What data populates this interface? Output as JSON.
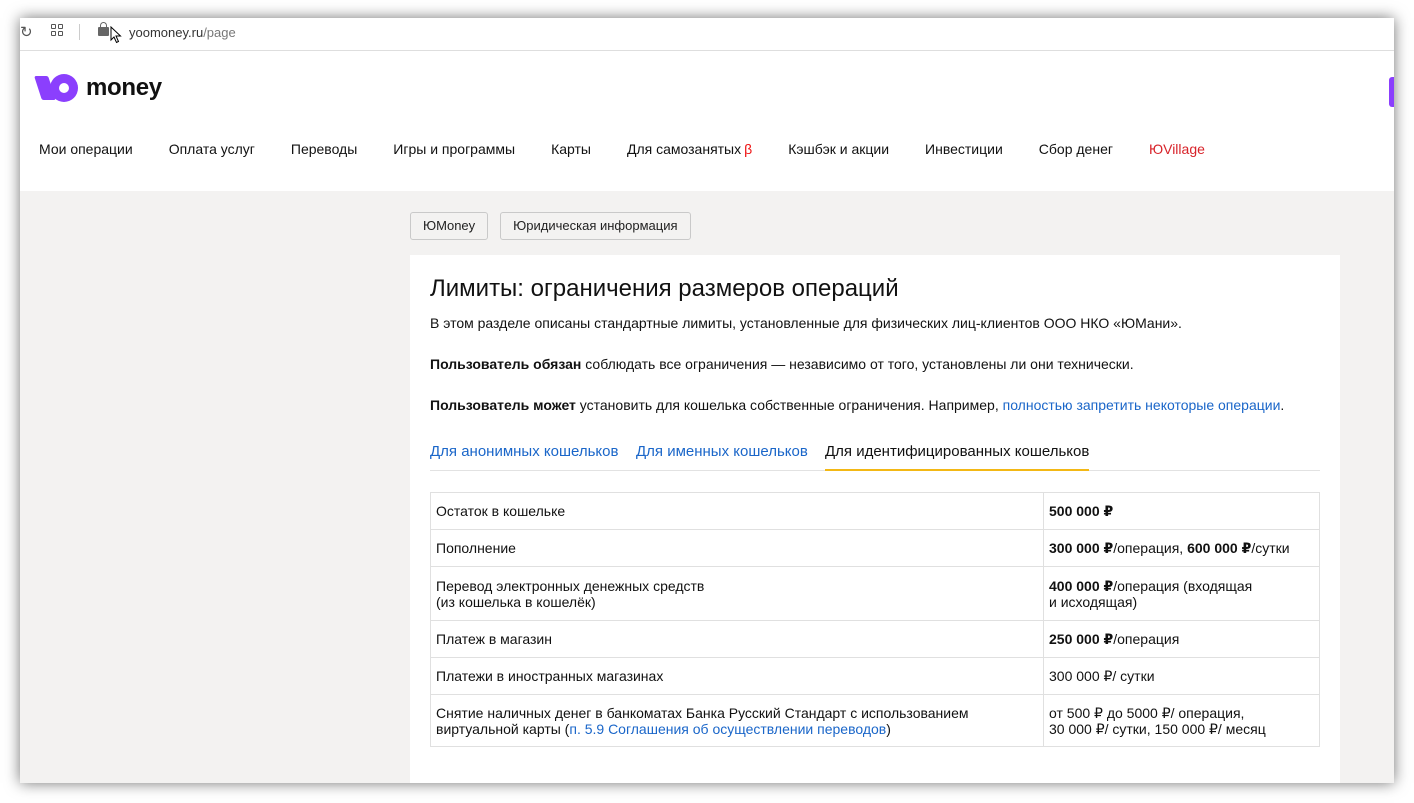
{
  "browser": {
    "url_domain": "yoomoney.ru",
    "url_path": "/page"
  },
  "header": {
    "logo_text": "money",
    "nav": [
      {
        "label": "Мои операции"
      },
      {
        "label": "Оплата услуг"
      },
      {
        "label": "Переводы"
      },
      {
        "label": "Игры и программы"
      },
      {
        "label": "Карты"
      },
      {
        "label": "Для самозанятых",
        "badge": "β"
      },
      {
        "label": "Кэшбэк и акции"
      },
      {
        "label": "Инвестиции"
      },
      {
        "label": "Сбор денег"
      },
      {
        "label": "ЮVillage"
      }
    ]
  },
  "breadcrumbs": [
    "ЮMoney",
    "Юридическая информация"
  ],
  "content": {
    "title": "Лимиты: ограничения размеров операций",
    "intro": "В этом разделе описаны стандартные лимиты, установленные для физических лиц-клиентов ООО НКО «ЮМани».",
    "p2_bold": "Пользователь обязан",
    "p2_rest": " соблюдать все ограничения — независимо от того, установлены ли они технически.",
    "p3_bold": "Пользователь может",
    "p3_rest": " установить для кошелька собственные ограничения. Например, ",
    "p3_link": "полностью запретить некоторые операции",
    "p3_end": ".",
    "tabs": [
      "Для анонимных кошельков",
      "Для именных кошельков",
      "Для идентифицированных кошельков"
    ],
    "table": {
      "r1_label": "Остаток в кошельке",
      "r1_value": "500 000 ₽",
      "r2_label": "Пополнение",
      "r2_v1": "300 000 ₽",
      "r2_t1": "/операция, ",
      "r2_v2": "600 000 ₽",
      "r2_t2": "/сутки",
      "r3_label_1": "Перевод электронных денежных средств",
      "r3_label_2": "(из кошелька в кошелёк)",
      "r3_v1": "400 000 ₽",
      "r3_t1": "/операция (входящая",
      "r3_t2": "и исходящая)",
      "r4_label": "Платеж в магазин",
      "r4_v1": "250 000 ₽",
      "r4_t1": "/операция",
      "r5_label": "Платежи в иностранных магазинах",
      "r5_value": "300 000 ₽/ сутки",
      "r6_label_1": "Снятие наличных денег в банкоматах Банка Русский Стандарт с использованием",
      "r6_label_2": "виртуальной карты (",
      "r6_link": "п. 5.9 Соглашения об осуществлении переводов",
      "r6_label_3": ")",
      "r6_value_1": "от 500 ₽ до 5000 ₽/ операция,",
      "r6_value_2": "30 000 ₽/ сутки, 150 000 ₽/ месяц"
    }
  },
  "colors": {
    "brand": "#8b3ffd",
    "link": "#1a66c9",
    "active_tab_underline": "#f3b815",
    "village": "#d8232a",
    "page_bg": "#f3f2f1"
  }
}
